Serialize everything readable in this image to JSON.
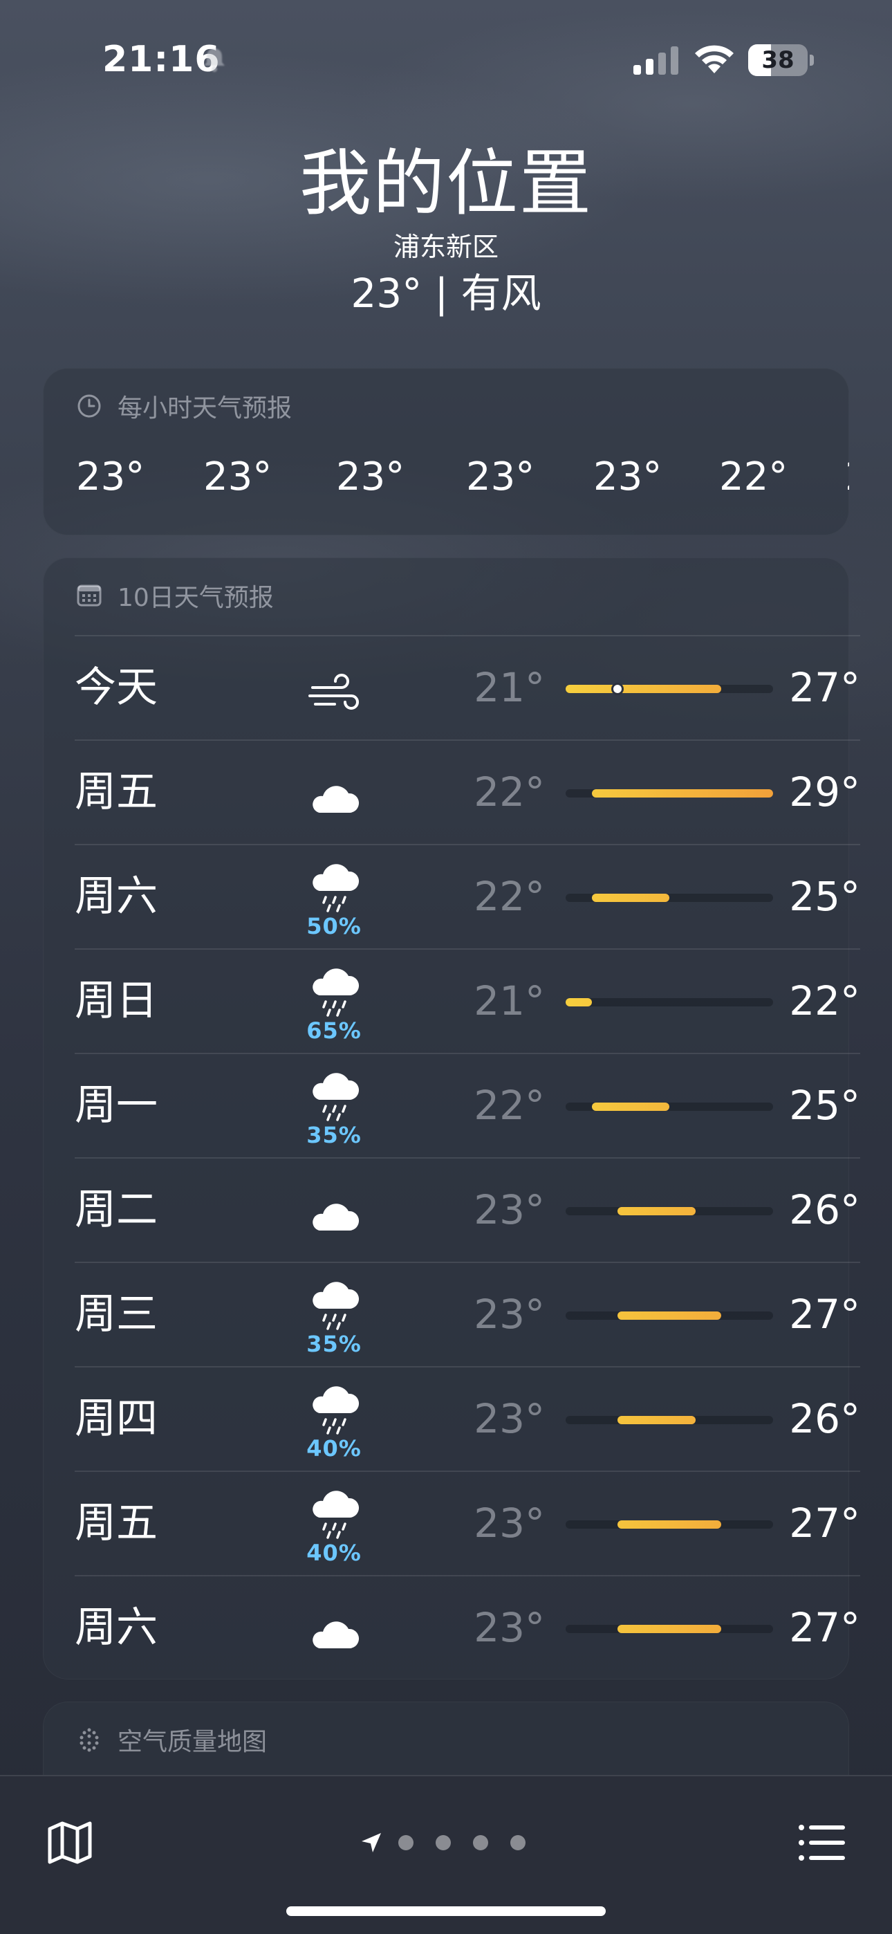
{
  "status_bar": {
    "time": "21:16",
    "battery_level": 38,
    "battery_text": "38",
    "icons": [
      "bell-muted-icon",
      "cellular-signal-icon",
      "wifi-icon",
      "battery-icon"
    ]
  },
  "header": {
    "title": "我的位置",
    "subtitle": "浦东新区",
    "summary": "23° | 有风"
  },
  "hourly": {
    "header": "每小时天气预报",
    "icon": "clock-icon",
    "temps": [
      "23°",
      "23°",
      "23°",
      "23°",
      "23°",
      "22°",
      "2"
    ]
  },
  "daily": {
    "header": "10日天气预报",
    "icon": "calendar-icon",
    "range_min": 21,
    "range_max": 29,
    "current_temp": 23,
    "days": [
      {
        "name": "今天",
        "icon": "wind-icon",
        "precip": "",
        "low": 21,
        "high": 27,
        "low_label": "21°",
        "high_label": "27°"
      },
      {
        "name": "周五",
        "icon": "cloud-icon",
        "precip": "",
        "low": 22,
        "high": 29,
        "low_label": "22°",
        "high_label": "29°"
      },
      {
        "name": "周六",
        "icon": "cloud-rain-icon",
        "precip": "50%",
        "low": 22,
        "high": 25,
        "low_label": "22°",
        "high_label": "25°"
      },
      {
        "name": "周日",
        "icon": "cloud-rain-icon",
        "precip": "65%",
        "low": 21,
        "high": 22,
        "low_label": "21°",
        "high_label": "22°"
      },
      {
        "name": "周一",
        "icon": "cloud-rain-icon",
        "precip": "35%",
        "low": 22,
        "high": 25,
        "low_label": "22°",
        "high_label": "25°"
      },
      {
        "name": "周二",
        "icon": "cloud-icon",
        "precip": "",
        "low": 23,
        "high": 26,
        "low_label": "23°",
        "high_label": "26°"
      },
      {
        "name": "周三",
        "icon": "cloud-rain-icon",
        "precip": "35%",
        "low": 23,
        "high": 27,
        "low_label": "23°",
        "high_label": "27°"
      },
      {
        "name": "周四",
        "icon": "cloud-rain-icon",
        "precip": "40%",
        "low": 23,
        "high": 26,
        "low_label": "23°",
        "high_label": "26°"
      },
      {
        "name": "周五",
        "icon": "cloud-rain-icon",
        "precip": "40%",
        "low": 23,
        "high": 27,
        "low_label": "23°",
        "high_label": "27°"
      },
      {
        "name": "周六",
        "icon": "cloud-icon",
        "precip": "",
        "low": 23,
        "high": 27,
        "low_label": "23°",
        "high_label": "27°"
      }
    ]
  },
  "air_quality": {
    "header": "空气质量地图",
    "icon": "air-quality-icon"
  },
  "bottom_bar": {
    "left_icon": "map-icon",
    "right_icon": "list-icon",
    "page_count": 5,
    "active_page": 0
  },
  "colors": {
    "precip": "#6cc7ff",
    "range_low": "#f6cf3e",
    "range_high": "#f2a13a"
  }
}
